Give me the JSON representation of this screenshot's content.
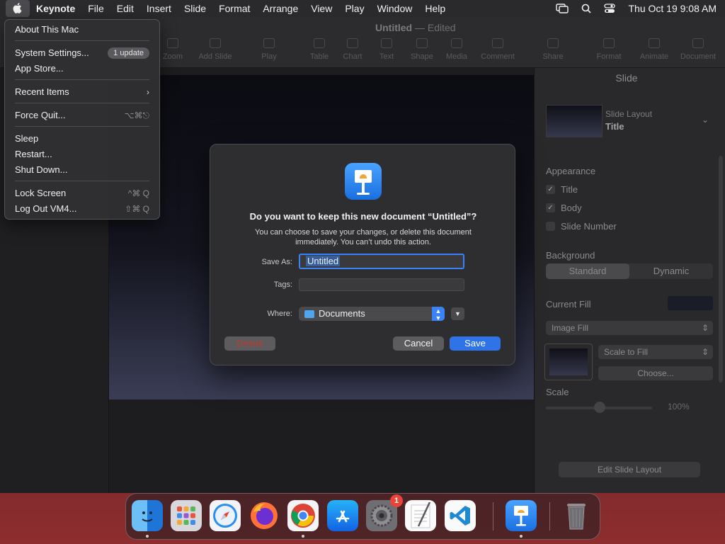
{
  "menubar": {
    "app_name": "Keynote",
    "items": [
      "File",
      "Edit",
      "Insert",
      "Slide",
      "Format",
      "Arrange",
      "View",
      "Play",
      "Window",
      "Help"
    ],
    "clock": "Thu Oct 19  9:08 AM"
  },
  "apple_menu": {
    "about": "About This Mac",
    "system_settings": "System Settings...",
    "update_badge": "1 update",
    "app_store": "App Store...",
    "recent_items": "Recent Items",
    "force_quit": "Force Quit...",
    "force_quit_shortcut": "⌥⌘⎋",
    "sleep": "Sleep",
    "restart": "Restart...",
    "shut_down": "Shut Down...",
    "lock_screen": "Lock Screen",
    "lock_shortcut": "^⌘ Q",
    "log_out": "Log Out VM4...",
    "log_out_shortcut": "⇧⌘ Q"
  },
  "toolbar": {
    "doc_title": "Untitled",
    "doc_status": "— Edited",
    "tools": [
      "Zoom",
      "Add Slide",
      "Play",
      "Table",
      "Chart",
      "Text",
      "Shape",
      "Media",
      "Comment",
      "Share",
      "Format",
      "Animate",
      "Document"
    ]
  },
  "inspector": {
    "title": "Slide",
    "layout_label": "Slide Layout",
    "layout_value": "Title",
    "appearance": "Appearance",
    "check_title": "Title",
    "check_body": "Body",
    "check_slide_number": "Slide Number",
    "background": "Background",
    "seg_standard": "Standard",
    "seg_dynamic": "Dynamic",
    "current_fill": "Current Fill",
    "image_fill": "Image Fill",
    "scale_to_fill": "Scale to Fill",
    "choose": "Choose...",
    "scale": "Scale",
    "scale_value": "100%",
    "edit_layout": "Edit Slide Layout"
  },
  "dialog": {
    "heading": "Do you want to keep this new document “Untitled”?",
    "message": "You can choose to save your changes, or delete this document immediately. You can’t undo this action.",
    "save_as_label": "Save As:",
    "save_as_value": "Untitled",
    "tags_label": "Tags:",
    "tags_value": "",
    "where_label": "Where:",
    "where_value": "Documents",
    "delete_label": "Delete",
    "cancel_label": "Cancel",
    "save_label": "Save"
  },
  "dock": {
    "apps": [
      "Finder",
      "Launchpad",
      "Safari",
      "Firefox",
      "Chrome",
      "App Store",
      "System Settings",
      "TextEdit",
      "Visual Studio Code",
      "Keynote",
      "Trash"
    ],
    "settings_badge": "1"
  }
}
